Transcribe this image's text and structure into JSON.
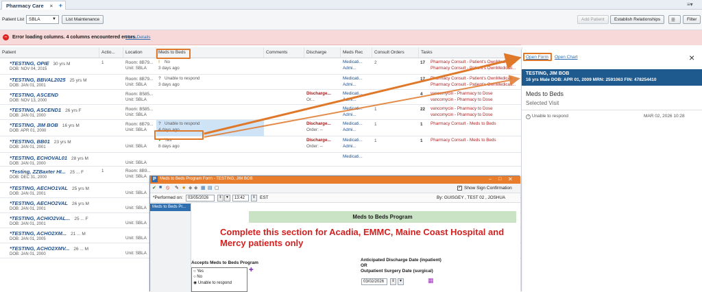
{
  "tabs": {
    "active": "Pharmacy Care Organizer",
    "close": "×",
    "add": "+"
  },
  "toolbar": {
    "patient_list_label": "Patient List",
    "patient_list_value": "SBLA",
    "list_maintenance": "List Maintenance",
    "add_patient": "Add Patient",
    "establish_relationships": "Establish Relationships",
    "filter": "Filter"
  },
  "error": {
    "message": "Error loading columns. 4 columns encountered errors.",
    "link": "More Details"
  },
  "columns": [
    "Patient",
    "Actio...",
    "Location",
    "Meds to Beds",
    "Comments",
    "Discharge",
    "Meds Rec",
    "Consult Orders",
    "Tasks"
  ],
  "patients": [
    {
      "name": "*TESTING, OPIE",
      "meta": "30 yrs  M",
      "dob": "DOB: NOV 04, 2015",
      "action": "1",
      "room": "Room: 8B79...",
      "unit": "Unit: SBLA",
      "meds_status": "No",
      "meds_sub": "3 days ago",
      "discharge": "",
      "discharge_sub": "",
      "medsrec1": "Medicati...",
      "medsrec2": "Admi...",
      "consult": "2",
      "task_count": "17",
      "task1": "Pharmacy Consult - Patient's OwnMedicati...",
      "task2": "Pharmacy Consult - Patient's OwnMedicati..."
    },
    {
      "name": "*TESTING, BBVAL2025",
      "meta": "25 yrs  M",
      "dob": "DOB: JAN 01, 2001",
      "action": "",
      "room": "Room: 8B79...",
      "unit": "Unit: SBLA",
      "meds_status": "Unable to respond",
      "meds_sub": "3 days ago",
      "discharge": "",
      "discharge_sub": "",
      "medsrec1": "Medicati...",
      "medsrec2": "Admi...",
      "consult": "",
      "task_count": "17",
      "task1": "Pharmacy Consult - Patient's OwnMedicati...",
      "task2": "Pharmacy Consult - Patient's OwnMedicati..."
    },
    {
      "name": "*TESTING, ASCEND",
      "meta": "",
      "dob": "DOB: NOV 13, 2000",
      "action": "",
      "room": "Room: B585...",
      "unit": "Unit: SBLA",
      "meds_status": "",
      "meds_sub": "",
      "discharge": "Discharge...",
      "discharge_sub": "Or...",
      "medsrec1": "Medicati...",
      "medsrec2": "Admi...",
      "consult": "",
      "task_count": "4",
      "task1": "vancomycin - Pharmacy to Dose",
      "task2": "vancomycin - Pharmacy to Dose"
    },
    {
      "name": "*TESTING, ASCEND1",
      "meta": "26 yrs  F",
      "dob": "DOB: JAN 01, 2000",
      "action": "",
      "room": "Room: B585...",
      "unit": "Unit: SBLA",
      "meds_status": "",
      "meds_sub": "",
      "discharge": "",
      "discharge_sub": "",
      "medsrec1": "Medicati...",
      "medsrec2": "Admi...",
      "consult": "1",
      "task_count": "22",
      "task1": "vancomycin - Pharmacy to Dose",
      "task2": "vancomycin - Pharmacy to Dose"
    },
    {
      "name": "*TESTING, JIM BOB",
      "meta": "16 yrs  M",
      "dob": "DOB: APR 01, 2000",
      "action": "",
      "room": "Room: 8B79...",
      "unit": "Unit: SBLA",
      "meds_status": "Unable to respond",
      "meds_sub": "4 days ago",
      "discharge": "Discharge...",
      "discharge_sub": "Order: --",
      "medsrec1": "Medicati...",
      "medsrec2": "Admi...",
      "consult": "1",
      "task_count": "1",
      "task1": "Pharmacy Consult - Meds to Beds",
      "task2": ""
    },
    {
      "name": "*TESTING, BB01",
      "meta": "23 yrs  M",
      "dob": "DOB: JAN 01, 2001",
      "action": "",
      "room": "",
      "unit": "Unit: SBLA",
      "meds_status": "Yes",
      "meds_sub": "8 days ago",
      "discharge": "Discharge...",
      "discharge_sub": "Order: --",
      "medsrec1": "Medicati...",
      "medsrec2": "Admi...",
      "consult": "1",
      "task_count": "1",
      "task1": "Pharmacy Consult - Meds to Beds",
      "task2": ""
    },
    {
      "name": "*TESTING, ECHOVAL01",
      "meta": "28 yrs  M",
      "dob": "DOB: JAN 01, 2000",
      "action": "",
      "room": "",
      "unit": "Unit: SBLA",
      "meds_status": "",
      "meds_sub": "",
      "discharge": "",
      "discharge_sub": "",
      "medsrec1": "Medicati...",
      "medsrec2": "",
      "consult": "",
      "task_count": "",
      "task1": "",
      "task2": ""
    },
    {
      "name": "*Testing, ZZBaxter  HI...",
      "meta": "25 ...  F",
      "dob": "DOB: DEC 31, 2000",
      "action": "1",
      "room": "Room: 8B9...",
      "unit": "Unit: SBLA",
      "meds_status": "",
      "meds_sub": "",
      "discharge": "",
      "discharge_sub": "",
      "medsrec1": "",
      "medsrec2": "",
      "consult": "",
      "task_count": "",
      "task1": "",
      "task2": ""
    },
    {
      "name": "*TESTING, AECHO1VAL",
      "meta": "25 yrs  M",
      "dob": "DOB: JAN 01, 2001",
      "action": "",
      "room": "",
      "unit": "Unit: SBLA",
      "meds_status": "",
      "meds_sub": "",
      "discharge": "",
      "discharge_sub": "",
      "medsrec1": "",
      "medsrec2": "",
      "consult": "",
      "task_count": "",
      "task1": "",
      "task2": ""
    },
    {
      "name": "*TESTING, AECHO2VAL",
      "meta": "26 yrs  M",
      "dob": "DOB: JAN 01, 2001",
      "action": "",
      "room": "",
      "unit": "Unit: SBLA",
      "meds_status": "",
      "meds_sub": "",
      "discharge": "",
      "discharge_sub": "",
      "medsrec1": "",
      "medsrec2": "",
      "consult": "",
      "task_count": "",
      "task1": "",
      "task2": ""
    },
    {
      "name": "*TESTING, ACHIO2VAL...",
      "meta": "25 ...  F",
      "dob": "DOB: JAN 01, 2001",
      "action": "",
      "room": "",
      "unit": "Unit: SBLA",
      "meds_status": "",
      "meds_sub": "",
      "discharge": "",
      "discharge_sub": "",
      "medsrec1": "",
      "medsrec2": "",
      "consult": "",
      "task_count": "",
      "task1": "",
      "task2": ""
    },
    {
      "name": "*TESTING, ACHO2XM...",
      "meta": "21 ...  M",
      "dob": "DOB: JAN 01, 2005",
      "action": "",
      "room": "",
      "unit": "Unit: SBLA",
      "meds_status": "",
      "meds_sub": "",
      "discharge": "",
      "discharge_sub": "",
      "medsrec1": "",
      "medsrec2": "",
      "consult": "",
      "task_count": "",
      "task1": "",
      "task2": ""
    },
    {
      "name": "*TESTING, ACHO2XMV...",
      "meta": "26 ...  M",
      "dob": "DOB: JAN 01, 2000",
      "action": "",
      "room": "",
      "unit": "Unit: SBLA",
      "meds_status": "",
      "meds_sub": "",
      "discharge": "",
      "discharge_sub": "",
      "medsrec1": "",
      "medsrec2": "",
      "consult": "",
      "task_count": "",
      "task1": "",
      "task2": ""
    }
  ],
  "right_panel": {
    "open_form": "Open Form",
    "open_chart": "Open Chart",
    "close": "×",
    "patient_name": "TESTING, JIM BOB",
    "patient_line": "16 yrs  Male  DOB: APR 01, 2009  MRN: 2591063  FIN: 478254410",
    "section_title": "Meds to Beds",
    "section_sub": "Selected Visit",
    "entry_status": "Unable to respond",
    "entry_date": "MAR 02, 2026 10:28"
  },
  "popup": {
    "title": "Meds to Beds Program Form - TESTING, JIM BOB",
    "show_sign": "Show Sign Confirmation",
    "performed_label": "*Performed on:",
    "performed_date": "03/05/2026",
    "performed_time": "13:42",
    "tz": "EST",
    "by": "By:  GUISGEY , TEST 02 , JOSHUA",
    "side_item": "Meds to Beds Pr...",
    "banner": "Meds to Beds Program",
    "big_text": "Complete this section for Acadia, EMMC, Maine Coast Hospital and Mercy patients only",
    "accepts_label": "Accepts Meds to Beds Program",
    "options": [
      "Yes",
      "No",
      "Unable to respond"
    ],
    "anticipated_line1": "Anticipated Discharge Date (inpatient)",
    "anticipated_or": "OR",
    "anticipated_line2": "Outpatient Surgery Date (surgical)",
    "anticipated_value": "03/02/2026"
  },
  "colors": {
    "accent_orange": "#e0782a",
    "header_blue": "#1f5a8f",
    "error_pink": "#f8d9d9",
    "task_red": "#b32424"
  }
}
